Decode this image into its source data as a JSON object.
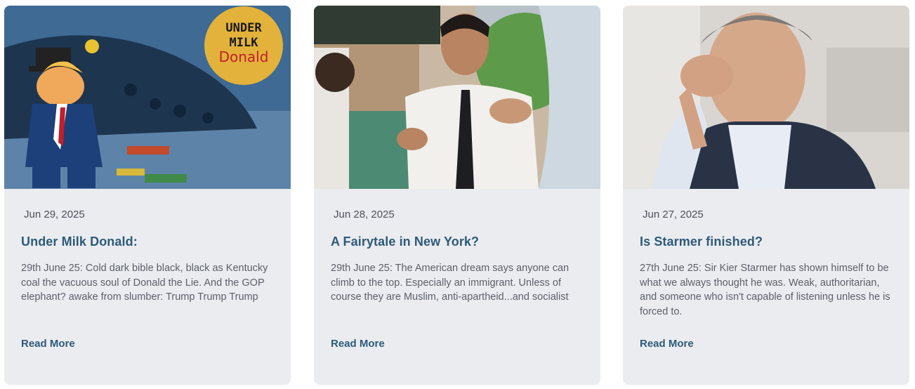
{
  "posts": [
    {
      "date": "Jun 29, 2025",
      "title": "Under Milk Donald:",
      "excerpt": "29th June 25: Cold dark bible black, black as Kentucky coal the vacuous soul of Donald the Lie. And the GOP elephant? awake from slumber: Trump Trump Trump",
      "read_more": "Read More",
      "image_badge": [
        "UNDER",
        "MILK",
        "Donald"
      ]
    },
    {
      "date": "Jun 28, 2025",
      "title": "A Fairytale in New York?",
      "excerpt": "29th June 25: The American dream says anyone can climb to the top. Especially an immigrant. Unless of course they are Muslim, anti-apartheid...and socialist",
      "read_more": "Read More"
    },
    {
      "date": "Jun 27, 2025",
      "title": "Is Starmer finished?",
      "excerpt": "27th June 25: Sir Kier Starmer has shown himself to be what we always thought he was. Weak, authoritarian, and someone who isn't capable of listening unless he is forced to.",
      "read_more": "Read More"
    }
  ],
  "colors": {
    "card_bg": "#ebecf0",
    "title": "#2d5a78",
    "text": "#5b6068"
  }
}
